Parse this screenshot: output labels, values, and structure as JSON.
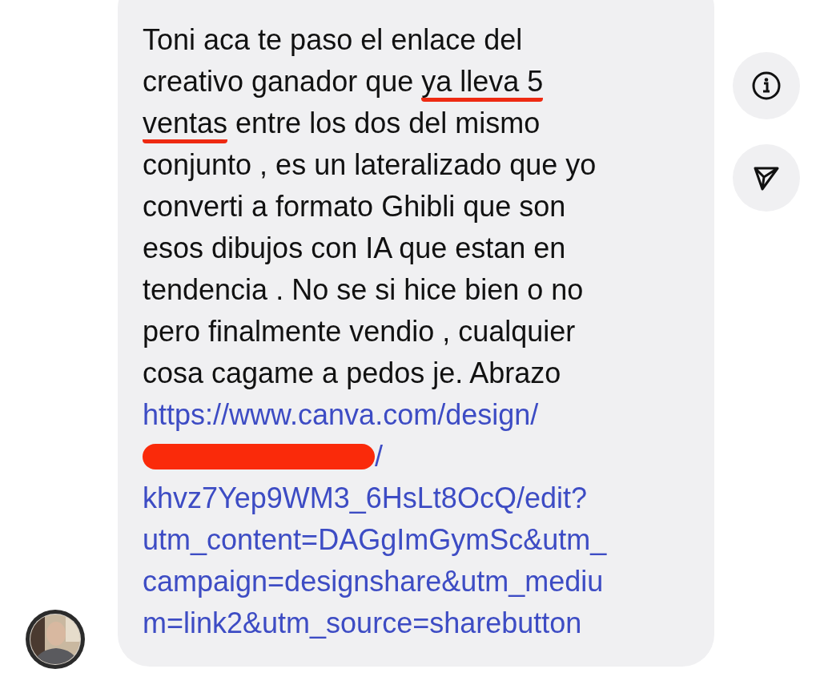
{
  "message": {
    "lines": [
      [
        {
          "text": "Toni aca te paso el enlace del",
          "underlined": false
        }
      ],
      [
        {
          "text": "creativo ganador que ",
          "underlined": false
        },
        {
          "text": "ya lleva 5",
          "underlined": true
        }
      ],
      [
        {
          "text": "ventas",
          "underlined": true
        },
        {
          "text": " entre los dos del mismo",
          "underlined": false
        }
      ],
      [
        {
          "text": "conjunto , es un lateralizado que yo",
          "underlined": false
        }
      ],
      [
        {
          "text": "converti a formato Ghibli que son",
          "underlined": false
        }
      ],
      [
        {
          "text": "esos dibujos con IA que estan en",
          "underlined": false
        }
      ],
      [
        {
          "text": "tendencia . No se si hice bien o no",
          "underlined": false
        }
      ],
      [
        {
          "text": "pero finalmente vendio , cualquier",
          "underlined": false
        }
      ],
      [
        {
          "text": "cosa cagame a pedos je. Abrazo",
          "underlined": false
        }
      ]
    ],
    "link_lines": [
      {
        "text": "https://www.canva.com/design/",
        "redacted": false
      },
      {
        "text": "/",
        "redacted": true
      },
      {
        "text": "khvz7Yep9WM3_6HsLt8OcQ/edit?",
        "redacted": false
      },
      {
        "text": "utm_content=DAGgImGymSc&utm_",
        "redacted": false
      },
      {
        "text": "campaign=designshare&utm_mediu",
        "redacted": false
      },
      {
        "text": "m=link2&utm_source=sharebutton",
        "redacted": false
      }
    ]
  }
}
